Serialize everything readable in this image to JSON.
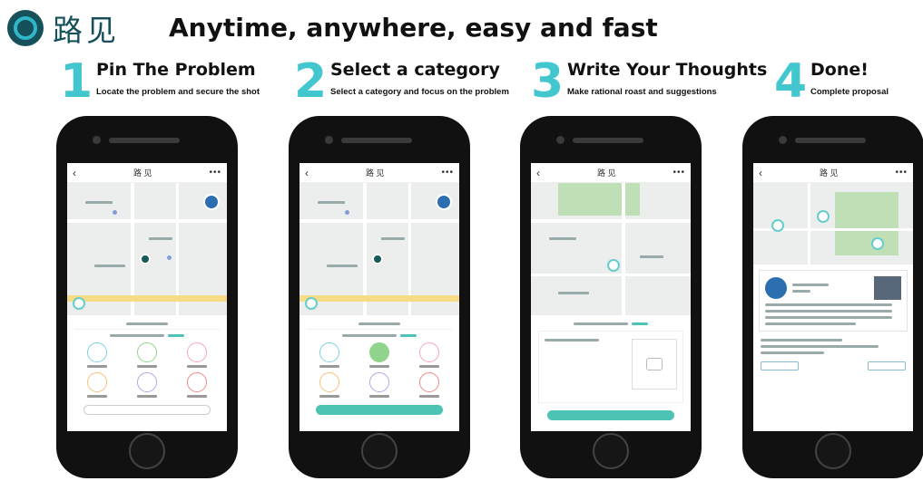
{
  "header": {
    "logo_text": "路见",
    "tagline": "Anytime, anywhere, easy and fast"
  },
  "steps": [
    {
      "number": "1",
      "title": "Pin The Problem",
      "subtitle": "Locate the problem and secure the shot"
    },
    {
      "number": "2",
      "title": "Select a category",
      "subtitle": "Select a category and focus on the problem"
    },
    {
      "number": "3",
      "title": "Write Your Thoughts",
      "subtitle": "Make rational roast and suggestions"
    },
    {
      "number": "4",
      "title": "Done!",
      "subtitle": "Complete proposal"
    }
  ],
  "phone_screens": {
    "nav_title": "路 见",
    "back_glyph": "‹",
    "more_glyph": "•••"
  },
  "colors": {
    "brand_dark": "#15505b",
    "accent": "#43c7ce",
    "button_teal": "#4cc3b5"
  }
}
